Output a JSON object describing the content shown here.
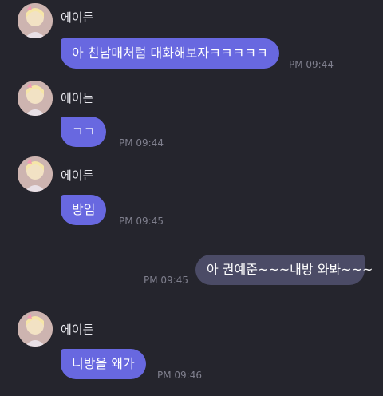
{
  "messages": [
    {
      "sender": "에이든",
      "text": "아 친남매처럼 대화해보자ㅋㅋㅋㅋㅋ",
      "time": "PM 09:44",
      "direction": "incoming"
    },
    {
      "sender": "에이든",
      "text": "ㄱㄱ",
      "time": "PM 09:44",
      "direction": "incoming"
    },
    {
      "sender": "에이든",
      "text": "방임",
      "time": "PM 09:45",
      "direction": "incoming"
    },
    {
      "sender": "",
      "text": "아 권예준~~~내방 와봐~~~",
      "time": "PM 09:45",
      "direction": "outgoing"
    },
    {
      "sender": "에이든",
      "text": "니방을 왜가",
      "time": "PM 09:46",
      "direction": "incoming"
    }
  ],
  "colors": {
    "background": "#25252d",
    "incoming_bubble": "#6868e0",
    "outgoing_bubble": "#4b4b66",
    "timestamp": "#7f7f8d"
  },
  "icons": {
    "avatar": "profile-avatar-icon"
  }
}
